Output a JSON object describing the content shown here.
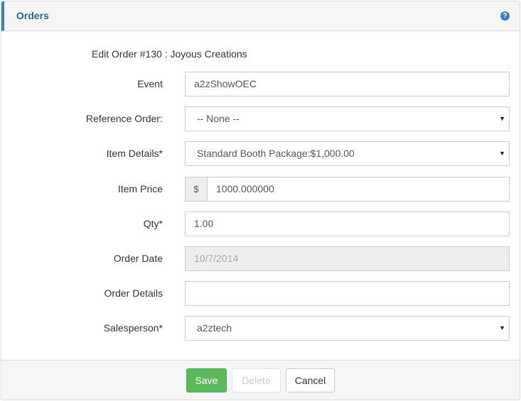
{
  "panel": {
    "title": "Orders",
    "help_icon": "?",
    "accent_color": "#3a7fc1"
  },
  "form": {
    "subtitle": "Edit Order #130 : Joyous Creations",
    "event": {
      "label": "Event",
      "value": "a2zShowOEC"
    },
    "reference_order": {
      "label": "Reference Order:",
      "value": "-- None --"
    },
    "item_details": {
      "label": "Item Details*",
      "value": "Standard Booth Package:$1,000.00"
    },
    "item_price": {
      "label": "Item Price",
      "currency_symbol": "$",
      "value": "1000.000000"
    },
    "qty": {
      "label": "Qty*",
      "value": "1.00"
    },
    "order_date": {
      "label": "Order Date",
      "value": "10/7/2014"
    },
    "order_details": {
      "label": "Order Details",
      "value": ""
    },
    "salesperson": {
      "label": "Salesperson*",
      "value": "a2ztech"
    },
    "dropdown_caret": "▼"
  },
  "footer": {
    "save_label": "Save",
    "delete_label": "Delete",
    "cancel_label": "Cancel",
    "save_color": "#5cb85c"
  }
}
